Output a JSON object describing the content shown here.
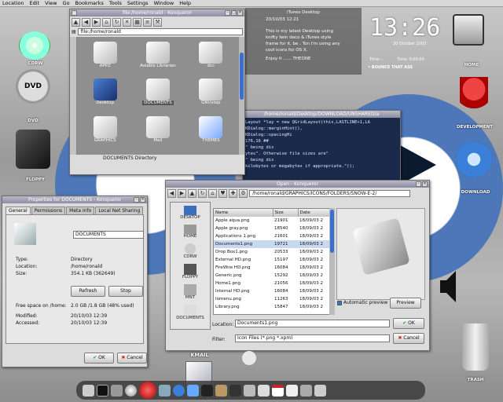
{
  "menubar": [
    "Location",
    "Edit",
    "View",
    "Go",
    "Bookmarks",
    "Tools",
    "Settings",
    "Window",
    "Help"
  ],
  "desktop": {
    "icons": [
      {
        "label": "CDRW"
      },
      {
        "label": "DVD"
      },
      {
        "label": "FLOPPY"
      },
      {
        "label": "HOME"
      },
      {
        "label": "DEVELOPMENT"
      },
      {
        "label": "DOWNLOAD"
      },
      {
        "label": "TRASH"
      },
      {
        "label": "KMAIL"
      }
    ],
    "clock": {
      "time": "13:26",
      "date": "20 October 2003",
      "sub": "• BOUNCE THAT ASS"
    },
    "player": {
      "left": "Time: -",
      "right": "Time: 0:00:00"
    },
    "itunes": {
      "title": "iTunes Desktop",
      "date": "20/10/03 12:21",
      "body": "This is my latest Desktop using knifty Iwin deco & iTunes style frame for it, be . Ton I'm using any cool icons for OS X.",
      "sign": "Enjoy it ......      THEONE"
    }
  },
  "konqueror": {
    "title": "file:/home/ronald - Konqueror",
    "url": "file:/home/ronald",
    "items": [
      "APPZ",
      "Asiabls Librarian",
      "dcc",
      "Desktop",
      "DOCUMENTS",
      "GNUstep",
      "GRAPHICS",
      "Mail",
      "THEMES"
    ],
    "status": "DOCUMENTS  Directory"
  },
  "editor": {
    "title": "/home/ronald/Desktop/DOWNLOAD/UNSHARED/a",
    "lines": [
      "Layout *lay = new QGridLayout(this,LASTLINE+1,LA",
      "KDialog::marginHint(),",
      "                                        KDialog::spacingHi",
      "176,16 ##",
      "        \" being dis",
      "ytes\". Otherwise file sizes are\"",
      "        \" being dis",
      "kilobytes or megabytes if appropriate.\"));"
    ]
  },
  "properties": {
    "title": "Properties for DOCUMENTS - Konqueror",
    "tabs": [
      "General",
      "Permissions",
      "Meta Info",
      "Local Net Sharing"
    ],
    "name_value": "DOCUMENTS",
    "rows": [
      {
        "k": "Type:",
        "v": "Directory"
      },
      {
        "k": "Location:",
        "v": "/home/ronald"
      },
      {
        "k": "Size:",
        "v": "354.1 KB (362649)"
      }
    ],
    "refresh": "Refresh",
    "stop": "Stop",
    "free_label": "Free space on /home:",
    "free_value": "2.0 GB /1.8 GB (48% used)",
    "modified_k": "Modified:",
    "modified_v": "20/10/03 12:39",
    "accessed_k": "Accessed:",
    "accessed_v": "20/10/03 12:39",
    "ok": "OK",
    "cancel": "Cancel"
  },
  "open": {
    "title": "Open - Konqueror",
    "path": "/home/ronald/GRAPHICS/ICONS/FOLDERS/SNOW-E-2/",
    "places": [
      "DESKTOP",
      "HOME",
      "CDRW",
      "FLOPPY",
      "MNT",
      "DOCUMENTS"
    ],
    "headers": [
      "Name",
      "Size",
      "Date"
    ],
    "files": [
      {
        "name": "Apple aqua.png",
        "size": "21901",
        "date": "18/09/03 2"
      },
      {
        "name": "Apple gray.png",
        "size": "18540",
        "date": "18/09/03 2"
      },
      {
        "name": "Applications 1.png",
        "size": "21601",
        "date": "18/09/03 2"
      },
      {
        "name": "Documents1.png",
        "size": "19721",
        "date": "18/09/03 2"
      },
      {
        "name": "Drop Box1.png",
        "size": "20533",
        "date": "18/09/03 2"
      },
      {
        "name": "External HD.png",
        "size": "15197",
        "date": "18/09/03 2"
      },
      {
        "name": "FireWire HD.png",
        "size": "16084",
        "date": "18/09/03 2"
      },
      {
        "name": "Generic.png",
        "size": "15292",
        "date": "18/09/03 2"
      },
      {
        "name": "Home1.png",
        "size": "21056",
        "date": "18/09/03 2"
      },
      {
        "name": "Internal HD.png",
        "size": "16084",
        "date": "18/09/03 2"
      },
      {
        "name": "Iomenu.png",
        "size": "11263",
        "date": "18/09/03 2"
      },
      {
        "name": "Library.png",
        "size": "15847",
        "date": "18/09/03 2"
      }
    ],
    "auto_preview": "Automatic preview",
    "preview_btn": "Preview",
    "location_label": "Location:",
    "location_value": "Documents1.png",
    "filter_label": "Filter:",
    "filter_value": "Icon Files (*.png *.xpm)",
    "ok": "OK",
    "cancel": "Cancel"
  }
}
